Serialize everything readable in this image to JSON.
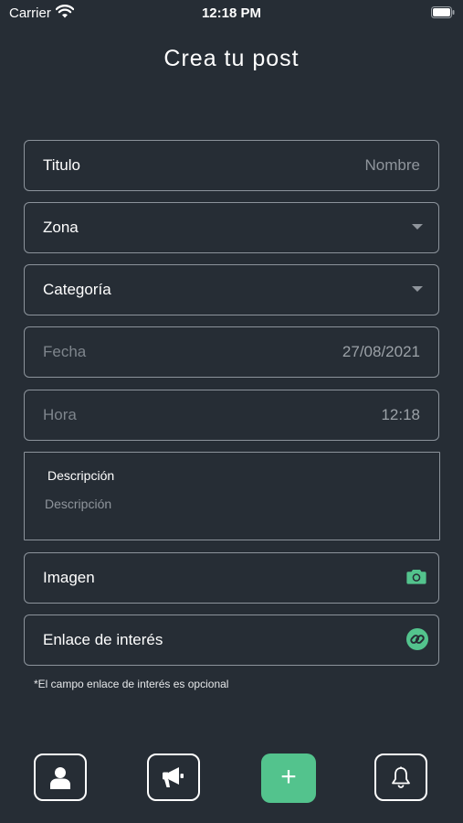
{
  "status_bar": {
    "carrier": "Carrier",
    "time": "12:18 PM"
  },
  "header": {
    "title": "Crea tu post"
  },
  "form": {
    "titulo": {
      "label": "Titulo",
      "placeholder": "Nombre"
    },
    "zona": {
      "label": "Zona"
    },
    "categoria": {
      "label": "Categoría"
    },
    "fecha": {
      "label": "Fecha",
      "value": "27/08/2021"
    },
    "hora": {
      "label": "Hora",
      "value": "12:18"
    },
    "descripcion": {
      "label": "Descripción",
      "placeholder": "Descripción"
    },
    "imagen": {
      "label": "Imagen",
      "icon": "camera-icon"
    },
    "enlace": {
      "label": "Enlace de interés",
      "icon": "link-icon"
    },
    "note": "*El campo enlace de interés es opcional"
  },
  "nav": {
    "items": [
      {
        "icon": "user-icon"
      },
      {
        "icon": "megaphone-icon"
      },
      {
        "icon": "plus-icon",
        "label": "+"
      },
      {
        "icon": "bell-icon"
      }
    ]
  },
  "colors": {
    "background": "#262d35",
    "accent": "#53c38d",
    "border": "#8c939b"
  }
}
